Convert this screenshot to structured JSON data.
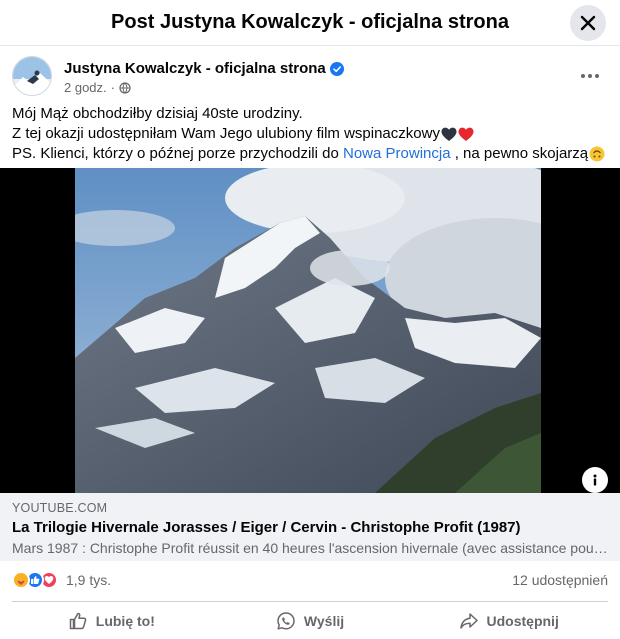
{
  "header": {
    "title": "Post Justyna Kowalczyk - oficjalna strona"
  },
  "post": {
    "author": "Justyna Kowalczyk - oficjalna strona",
    "time": "2 godz.",
    "text": {
      "line1": "Mój Mąż obchodziłby dzisiaj 40ste urodziny.",
      "line2": "Z tej okazji udostępniłam Wam Jego ulubiony film wspinaczkowy",
      "line3_before": "PS. Klienci, którzy o późnej porze przychodzili do",
      "line3_link": "Nowa Prowincja",
      "line3_after": ", na pewno skojarzą"
    }
  },
  "link_card": {
    "domain": "YOUTUBE.COM",
    "title": "La Trilogie Hivernale Jorasses / Eiger / Cervin - Christophe Profit (1987)",
    "description": "Mars 1987 : Christophe Profit réussit en 40 heures l'ascension hivernale (avec assistance pour l'ap..."
  },
  "stats": {
    "reactions_count": "1,9 tys.",
    "shares": "12 udostępnień"
  },
  "actions": {
    "like": "Lubię to!",
    "send": "Wyślij",
    "share": "Udostępnij"
  },
  "colors": {
    "link": "#216fdb",
    "verified": "#1877f2",
    "like": "#1877f2",
    "love": "#f33e58",
    "care": "#f7b125"
  }
}
